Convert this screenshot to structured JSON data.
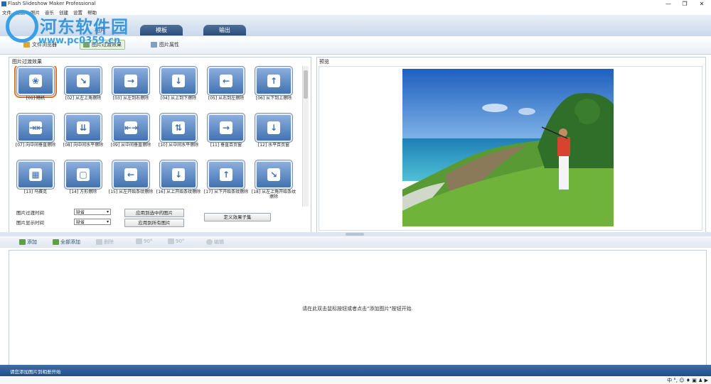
{
  "window": {
    "title": "Flash Slideshow Maker Professional",
    "minimize": "—",
    "maximize": "❐",
    "close": "✕"
  },
  "menu": [
    "文件",
    "视图",
    "照片",
    "音乐",
    "创建",
    "设置",
    "帮助"
  ],
  "watermark": {
    "text": "河东软件园",
    "url": "www.pc0359.cn"
  },
  "tabs": [
    {
      "label": "相片"
    },
    {
      "label": "模板"
    },
    {
      "label": "输出"
    }
  ],
  "subtabs": [
    {
      "label": "文件浏览器"
    },
    {
      "label": "图片过渡效果"
    },
    {
      "label": "图片属性"
    }
  ],
  "left_panel": {
    "title": "图片过渡效果",
    "transitions": [
      {
        "label": "[01] 随机",
        "glyph": "❀"
      },
      {
        "label": "[02] 从左上角擦除",
        "glyph": "↘"
      },
      {
        "label": "[03] 从左到右擦除",
        "glyph": "→"
      },
      {
        "label": "[04] 从上到下擦除",
        "glyph": "↓"
      },
      {
        "label": "[05] 从右到左擦除",
        "glyph": "←"
      },
      {
        "label": "[06] 从下到上擦除",
        "glyph": "↑"
      },
      {
        "label": "[07] 向中间垂直擦除",
        "glyph": "⇥⇤"
      },
      {
        "label": "[08] 向中间水平擦除",
        "glyph": "⇊"
      },
      {
        "label": "[09] 从中间垂直擦除",
        "glyph": "⇤⇥"
      },
      {
        "label": "[10] 从中间水平擦除",
        "glyph": "⇅"
      },
      {
        "label": "[11] 垂直百页窗",
        "glyph": "→"
      },
      {
        "label": "[12] 水平百页窗",
        "glyph": "↓"
      },
      {
        "label": "[13] 马赛克",
        "glyph": "▦"
      },
      {
        "label": "[14] 方形擦除",
        "glyph": "▢"
      },
      {
        "label": "[15] 从左开始条纹擦除",
        "glyph": "←"
      },
      {
        "label": "[16] 从上开始条纹擦除",
        "glyph": "↓"
      },
      {
        "label": "[17] 从下开始条纹擦除",
        "glyph": "↑"
      },
      {
        "label": "[18] 从左上角开始条纹擦除",
        "glyph": "↘"
      }
    ],
    "transition_time_label": "图片过渡时间",
    "display_time_label": "图片显示时间",
    "transition_time_value": "缺省",
    "display_time_value": "缺省",
    "apply_selected": "应用到选中的图片",
    "apply_all": "应用到所有图片",
    "define_subset": "定义效果子集"
  },
  "preview": {
    "title": "预览"
  },
  "toolbar": {
    "add": "添加",
    "add_all": "全部添加",
    "delete": "删除",
    "rotate_left": "90°",
    "rotate_right": "90°",
    "edit": "编辑"
  },
  "dropzone": {
    "hint": "请在此双击鼠标按钮或者点击\"添加图片\"按钮开始."
  },
  "status": {
    "text": "请您添加图片到相册开始"
  },
  "tray": {
    "text": "中 °, ☺ ♦ ▣ ♟ ▶"
  }
}
